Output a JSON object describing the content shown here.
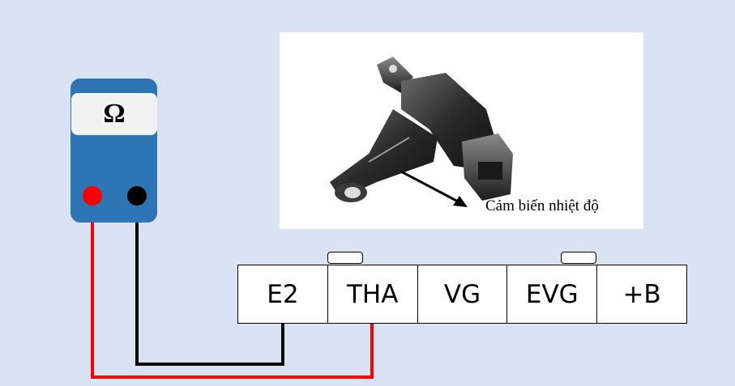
{
  "meter": {
    "symbol": "Ω"
  },
  "photo": {
    "caption": "Cảm biến nhiệt độ"
  },
  "connector": {
    "pins": [
      {
        "label": "E2"
      },
      {
        "label": "THA"
      },
      {
        "label": "VG"
      },
      {
        "label": "EVG"
      },
      {
        "label": "+B"
      }
    ]
  },
  "colors": {
    "background": "#dae3f3",
    "meter_body": "#2e75b6",
    "red_probe": "#ff0000",
    "black_probe": "#000000"
  }
}
